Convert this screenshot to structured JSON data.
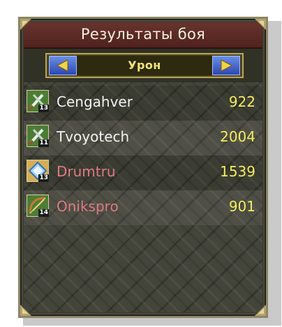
{
  "window": {
    "title": "Результаты боя"
  },
  "selector": {
    "label": "Урон",
    "prev_icon": "arrow-left-icon",
    "next_icon": "arrow-right-icon"
  },
  "colors": {
    "ally_name": "#f2f2f2",
    "enemy_name": "#e07a82",
    "score": "#f3ec5e"
  },
  "players": [
    {
      "name": "Cengahver",
      "score": "922",
      "level": "13",
      "class_icon": "crossed-swords-icon",
      "team": "ally"
    },
    {
      "name": "Tvoyotech",
      "score": "2004",
      "level": "11",
      "class_icon": "crossed-swords-icon",
      "team": "ally"
    },
    {
      "name": "Drumtru",
      "score": "1539",
      "level": "13",
      "class_icon": "mage-staff-icon",
      "team": "enemy"
    },
    {
      "name": "Onikspro",
      "score": "901",
      "level": "14",
      "class_icon": "bow-icon",
      "team": "enemy"
    }
  ]
}
